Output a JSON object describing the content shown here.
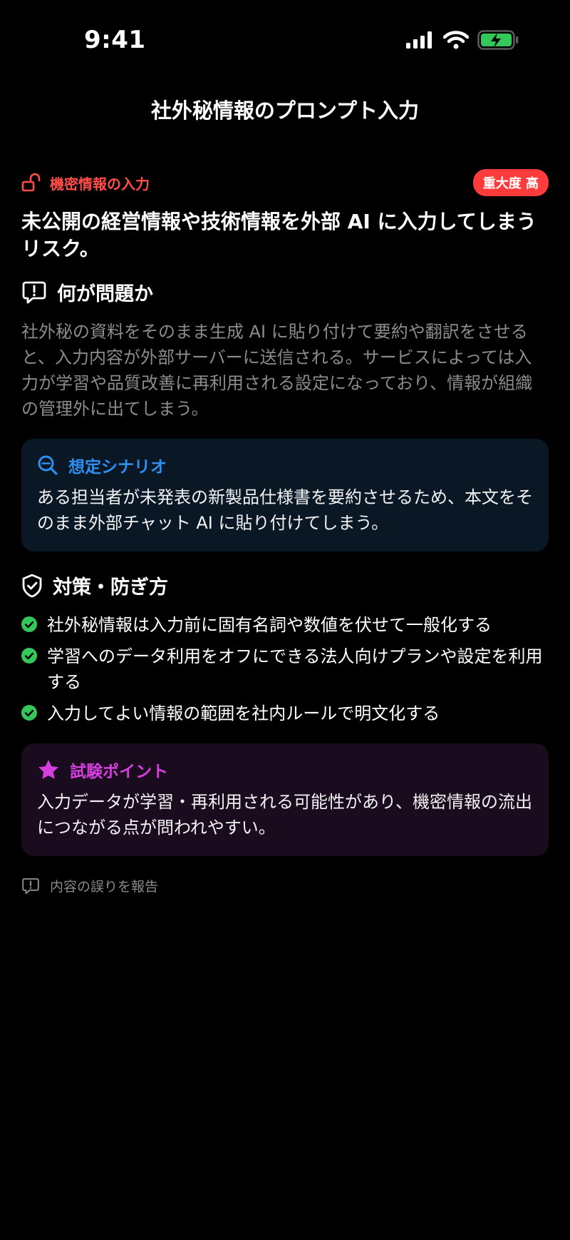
{
  "status_bar": {
    "time": "9:41"
  },
  "nav": {
    "title": "社外秘情報のプロンプト入力"
  },
  "category": {
    "label": "機密情報の入力",
    "icon": "unlock-icon",
    "color": "#ff4d4a"
  },
  "severity": {
    "label": "重大度 高",
    "color": "#ff3b3b"
  },
  "lead": "未公開の経営情報や技術情報を外部 AI に入力してしまうリスク。",
  "problem": {
    "heading": "何が問題か",
    "icon": "speech-bubble-exclamation-icon",
    "text": "社外秘の資料をそのまま生成 AI に貼り付けて要約や翻訳をさせると、入力内容が外部サーバーに送信される。サービスによっては入力が学習や品質改善に再利用される設定になっており、情報が組織の管理外に出てしまう。"
  },
  "scenario": {
    "heading": "想定シナリオ",
    "icon": "search-icon",
    "color": "#2d8ff0",
    "text": "ある担当者が未発表の新製品仕様書を要約させるため、本文をそのまま外部チャット AI に貼り付けてしまう。"
  },
  "measures": {
    "heading": "対策・防ぎ方",
    "icon": "shield-check-icon",
    "items": [
      "社外秘情報は入力前に固有名詞や数値を伏せて一般化する",
      "学習へのデータ利用をオフにできる法人向けプランや設定を利用する",
      "入力してよい情報の範囲を社内ルールで明文化する"
    ]
  },
  "exam": {
    "heading": "試験ポイント",
    "icon": "star-icon",
    "color": "#d43fe0",
    "text": "入力データが学習・再利用される可能性があり、機密情報の流出につながる点が問われやすい。"
  },
  "report": {
    "label": "内容の誤りを報告",
    "icon": "report-icon"
  }
}
